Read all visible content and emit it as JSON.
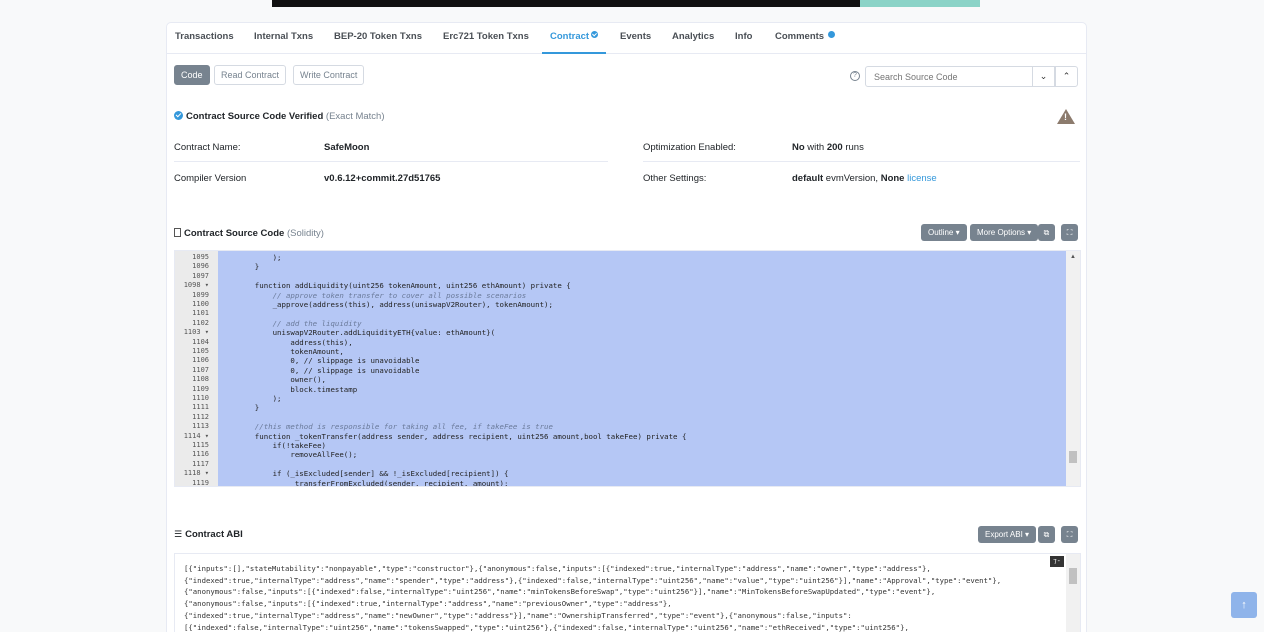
{
  "tabs": [
    {
      "label": "Transactions"
    },
    {
      "label": "Internal Txns"
    },
    {
      "label": "BEP-20 Token Txns"
    },
    {
      "label": "Erc721 Token Txns"
    },
    {
      "label": "Contract"
    },
    {
      "label": "Events"
    },
    {
      "label": "Analytics"
    },
    {
      "label": "Info"
    },
    {
      "label": "Comments"
    }
  ],
  "toolbar": {
    "code_label": "Code",
    "read_label": "Read Contract",
    "write_label": "Write Contract",
    "help_glyph": "?",
    "search_placeholder": "Search Source Code",
    "prev_glyph": "⌄",
    "next_glyph": "⌃"
  },
  "verified": {
    "title": "Contract Source Code Verified",
    "match": "(Exact Match)",
    "warning_glyph": "!"
  },
  "info": {
    "contract_name_label": "Contract Name:",
    "contract_name_value": "SafeMoon",
    "compiler_label": "Compiler Version",
    "compiler_value": "v0.6.12+commit.27d51765",
    "optimization_label": "Optimization Enabled:",
    "optimization_no": "No",
    "optimization_with": " with ",
    "optimization_runs": "200",
    "optimization_runs_suffix": " runs",
    "settings_label": "Other Settings:",
    "settings_default": "default",
    "settings_evm": " evmVersion, ",
    "settings_none": "None",
    "settings_license": "license"
  },
  "source": {
    "title": "Contract Source Code",
    "lang": "(Solidity)",
    "outline_label": "Outline",
    "more_label": "More Options",
    "copy_glyph": "⧉",
    "expand_glyph": "⛶",
    "lines": [
      {
        "n": "1095",
        "code": "        );"
      },
      {
        "n": "1096",
        "code": "    }"
      },
      {
        "n": "1097",
        "code": ""
      },
      {
        "n": "1098 ▾",
        "code": "    function addLiquidity(uint256 tokenAmount, uint256 ethAmount) private {"
      },
      {
        "n": "1099",
        "code": "        // approve token transfer to cover all possible scenarios"
      },
      {
        "n": "1100",
        "code": "        _approve(address(this), address(uniswapV2Router), tokenAmount);"
      },
      {
        "n": "1101",
        "code": ""
      },
      {
        "n": "1102",
        "code": "        // add the liquidity"
      },
      {
        "n": "1103 ▾",
        "code": "        uniswapV2Router.addLiquidityETH{value: ethAmount}("
      },
      {
        "n": "1104",
        "code": "            address(this),"
      },
      {
        "n": "1105",
        "code": "            tokenAmount,"
      },
      {
        "n": "1106",
        "code": "            0, // slippage is unavoidable"
      },
      {
        "n": "1107",
        "code": "            0, // slippage is unavoidable"
      },
      {
        "n": "1108",
        "code": "            owner(),"
      },
      {
        "n": "1109",
        "code": "            block.timestamp"
      },
      {
        "n": "1110",
        "code": "        );"
      },
      {
        "n": "1111",
        "code": "    }"
      },
      {
        "n": "1112",
        "code": ""
      },
      {
        "n": "1113",
        "code": "    //this method is responsible for taking all fee, if takeFee is true"
      },
      {
        "n": "1114 ▾",
        "code": "    function _tokenTransfer(address sender, address recipient, uint256 amount,bool takeFee) private {"
      },
      {
        "n": "1115",
        "code": "        if(!takeFee)"
      },
      {
        "n": "1116",
        "code": "            removeAllFee();"
      },
      {
        "n": "1117",
        "code": ""
      },
      {
        "n": "1118 ▾",
        "code": "        if (_isExcluded[sender] && !_isExcluded[recipient]) {"
      },
      {
        "n": "1119",
        "code": "            _transferFromExcluded(sender, recipient, amount);"
      }
    ]
  },
  "abi": {
    "title": "Contract ABI",
    "export_label": "Export ABI",
    "copy_glyph": "⧉",
    "expand_glyph": "⛶",
    "badge": "⁊-",
    "lines": [
      "[{\"inputs\":[],\"stateMutability\":\"nonpayable\",\"type\":\"constructor\"},{\"anonymous\":false,\"inputs\":[{\"indexed\":true,\"internalType\":\"address\",\"name\":\"owner\",\"type\":\"address\"},",
      "{\"indexed\":true,\"internalType\":\"address\",\"name\":\"spender\",\"type\":\"address\"},{\"indexed\":false,\"internalType\":\"uint256\",\"name\":\"value\",\"type\":\"uint256\"}],\"name\":\"Approval\",\"type\":\"event\"},",
      "{\"anonymous\":false,\"inputs\":[{\"indexed\":false,\"internalType\":\"uint256\",\"name\":\"minTokensBeforeSwap\",\"type\":\"uint256\"}],\"name\":\"MinTokensBeforeSwapUpdated\",\"type\":\"event\"},",
      "{\"anonymous\":false,\"inputs\":[{\"indexed\":true,\"internalType\":\"address\",\"name\":\"previousOwner\",\"type\":\"address\"},",
      "{\"indexed\":true,\"internalType\":\"address\",\"name\":\"newOwner\",\"type\":\"address\"}],\"name\":\"OwnershipTransferred\",\"type\":\"event\"},{\"anonymous\":false,\"inputs\":",
      "[{\"indexed\":false,\"internalType\":\"uint256\",\"name\":\"tokensSwapped\",\"type\":\"uint256\"},{\"indexed\":false,\"internalType\":\"uint256\",\"name\":\"ethReceived\",\"type\":\"uint256\"},"
    ]
  },
  "back_to_top_glyph": "↑"
}
